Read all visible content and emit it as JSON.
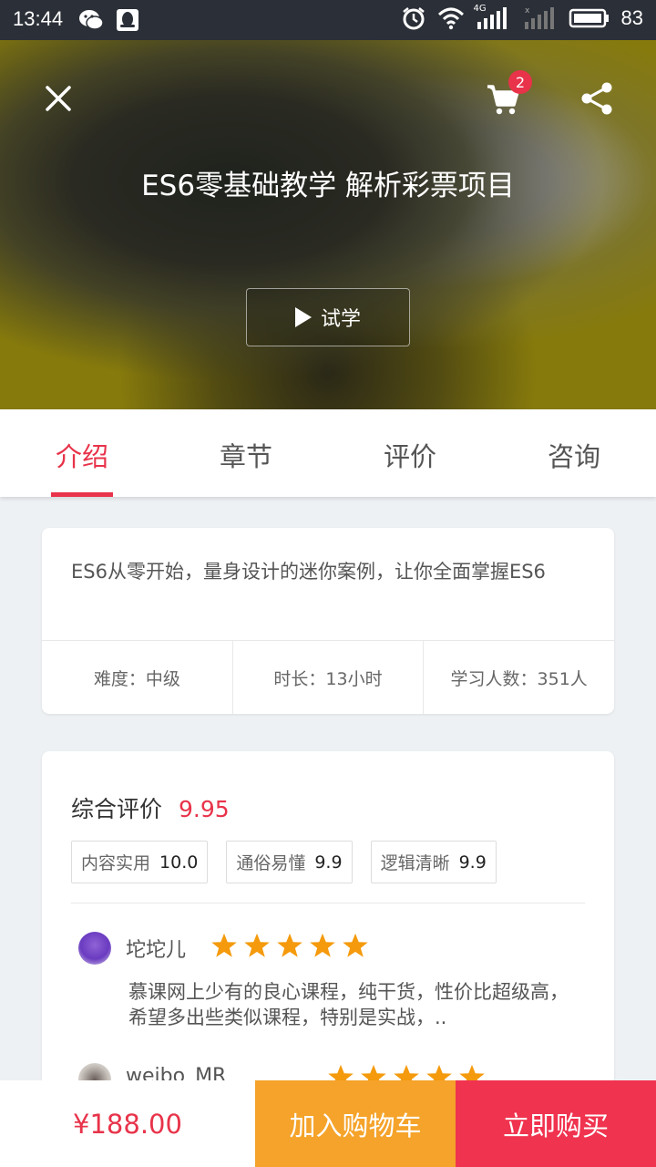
{
  "status_bar": {
    "time": "13:44",
    "battery": "83",
    "network": "4G",
    "left_icons": [
      "wechat-icon",
      "qq-icon"
    ],
    "right_icons": [
      "alarm-icon",
      "wifi-icon",
      "signal-icon",
      "signal-empty-icon",
      "battery-icon"
    ]
  },
  "hero": {
    "cart_count": "2",
    "title": "ES6零基础教学 解析彩票项目",
    "trial_label": "试学"
  },
  "tabs": [
    {
      "label": "介绍",
      "active": true
    },
    {
      "label": "章节",
      "active": false
    },
    {
      "label": "评价",
      "active": false
    },
    {
      "label": "咨询",
      "active": false
    }
  ],
  "intro": {
    "description": "ES6从零开始，量身设计的迷你案例，让你全面掌握ES6",
    "stats": [
      {
        "text": "难度：中级"
      },
      {
        "text": "时长：13小时"
      },
      {
        "text": "学习人数：351人"
      }
    ]
  },
  "reviews": {
    "overall_label": "综合评价",
    "overall_score": "9.95",
    "tags": [
      {
        "label": "内容实用",
        "score": "10.0"
      },
      {
        "label": "通俗易懂",
        "score": "9.9"
      },
      {
        "label": "逻辑清晰",
        "score": "9.9"
      }
    ],
    "items": [
      {
        "user": "坨坨儿",
        "rating": 5,
        "text": "慕课网上少有的良心课程，纯干货，性价比超级高，希望多出些类似课程，特别是实战，.."
      },
      {
        "user": "weibo_MR",
        "rating": 5,
        "text": ""
      }
    ]
  },
  "bottom_bar": {
    "price": "¥188.00",
    "add_to_cart": "加入购物车",
    "buy_now": "立即购买"
  },
  "colors": {
    "accent": "#e8334a",
    "cart_button": "#f5a32a",
    "buy_button": "#f0334f",
    "star": "#f49a0c",
    "status_bar": "#2b2f37"
  }
}
